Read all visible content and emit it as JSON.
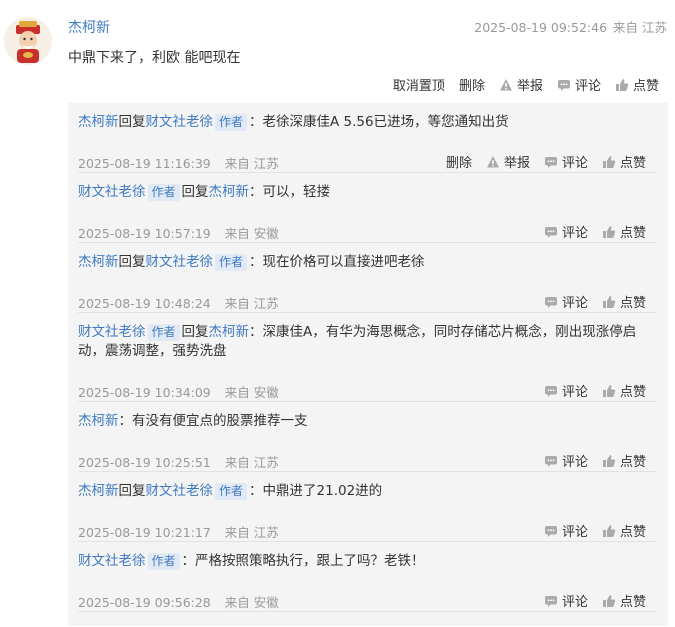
{
  "comment": {
    "user": "杰柯新",
    "time": "2025-08-19 09:52:46",
    "location": "来自 江苏",
    "content": "中鼎下来了，利欧 能吧现在",
    "actions": {
      "pin": "取消置顶",
      "delete": "删除",
      "report": "举报",
      "reply": "评论",
      "like": "点赞"
    }
  },
  "reply_actions": {
    "delete": "删除",
    "report": "举报",
    "reply": "评论",
    "like": "点赞"
  },
  "replies": [
    {
      "user": "杰柯新",
      "user_tag": "",
      "verb": "回复",
      "target": "财文社老徐",
      "target_tag": "作者",
      "content": "：老徐深康佳A 5.56已进场，等您通知出货",
      "time": "2025-08-19 11:16:39",
      "location": "来自 江苏"
    },
    {
      "user": "财文社老徐",
      "user_tag": "作者",
      "verb": "回复",
      "target": "杰柯新",
      "target_tag": "",
      "content": "：可以，轻搂",
      "time": "2025-08-19 10:57:19",
      "location": "来自 安徽"
    },
    {
      "user": "杰柯新",
      "user_tag": "",
      "verb": "回复",
      "target": "财文社老徐",
      "target_tag": "作者",
      "content": "：现在价格可以直接进吧老徐",
      "time": "2025-08-19 10:48:24",
      "location": "来自 江苏"
    },
    {
      "user": "财文社老徐",
      "user_tag": "作者",
      "verb": "回复",
      "target": "杰柯新",
      "target_tag": "",
      "content": "：深康佳A，有华为海思概念，同时存储芯片概念，刚出现涨停启动，震荡调整，强势洗盘",
      "time": "2025-08-19 10:34:09",
      "location": "来自 安徽"
    },
    {
      "user": "杰柯新",
      "user_tag": "",
      "verb": "",
      "target": "",
      "target_tag": "",
      "content": "：有没有便宜点的股票推荐一支",
      "time": "2025-08-19 10:25:51",
      "location": "来自 江苏"
    },
    {
      "user": "杰柯新",
      "user_tag": "",
      "verb": "回复",
      "target": "财文社老徐",
      "target_tag": "作者",
      "content": "：中鼎进了21.02进的",
      "time": "2025-08-19 10:21:17",
      "location": "来自 江苏"
    },
    {
      "user": "财文社老徐",
      "user_tag": "作者",
      "verb": "",
      "target": "",
      "target_tag": "",
      "content": "：严格按照策略执行，跟上了吗？老铁！",
      "time": "2025-08-19 09:56:28",
      "location": "来自 安徽"
    }
  ]
}
